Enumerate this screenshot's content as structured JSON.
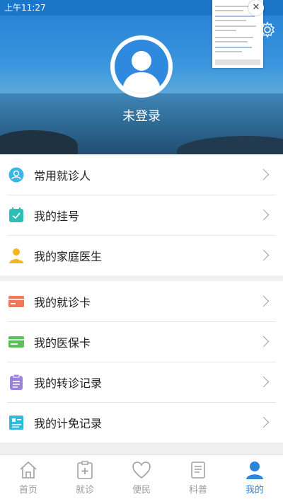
{
  "status_bar": {
    "time": "上午11:27"
  },
  "profile": {
    "login_status": "未登录"
  },
  "menu_groups": [
    {
      "items": [
        {
          "label": "常用就诊人",
          "icon": "patient-icon",
          "color": "#39b5e6"
        },
        {
          "label": "我的挂号",
          "icon": "register-calendar-icon",
          "color": "#2bbfb6"
        },
        {
          "label": "我的家庭医生",
          "icon": "doctor-icon",
          "color": "#f2b61c"
        }
      ]
    },
    {
      "items": [
        {
          "label": "我的就诊卡",
          "icon": "visit-card-icon",
          "color": "#f2765a"
        },
        {
          "label": "我的医保卡",
          "icon": "insurance-card-icon",
          "color": "#5cc05a"
        },
        {
          "label": "我的转诊记录",
          "icon": "referral-clipboard-icon",
          "color": "#9b82e0"
        },
        {
          "label": "我的计免记录",
          "icon": "vaccination-record-icon",
          "color": "#33b7dd"
        }
      ]
    }
  ],
  "tabs": [
    {
      "label": "首页",
      "icon": "home-icon",
      "active": false
    },
    {
      "label": "就诊",
      "icon": "medical-visit-icon",
      "active": false
    },
    {
      "label": "便民",
      "icon": "heart-icon",
      "active": false
    },
    {
      "label": "科普",
      "icon": "article-icon",
      "active": false
    },
    {
      "label": "我的",
      "icon": "user-icon",
      "active": true
    }
  ],
  "colors": {
    "accent": "#2a86d9",
    "status_bar": "#1b75c8"
  }
}
